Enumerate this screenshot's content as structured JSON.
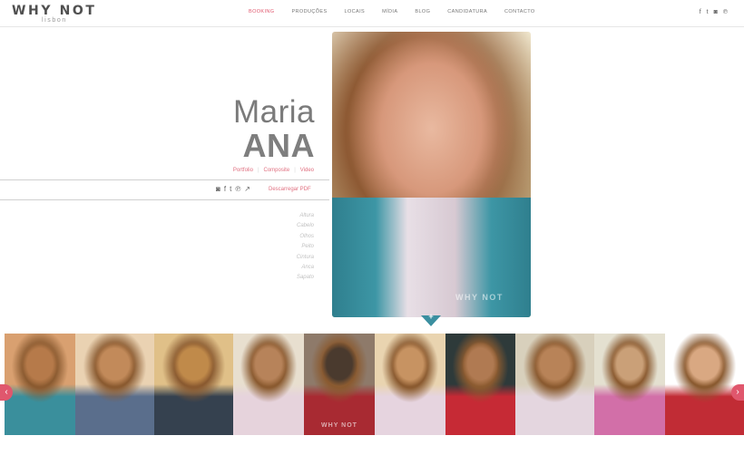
{
  "brand": {
    "logo": "WHY NOT",
    "tagline": "lisbon"
  },
  "nav": {
    "items": [
      {
        "label": "BOOKING",
        "active": true
      },
      {
        "label": "PRODUÇÕES",
        "active": false
      },
      {
        "label": "LOCAIS",
        "active": false
      },
      {
        "label": "MÍDIA",
        "active": false
      },
      {
        "label": "BLOG",
        "active": false
      },
      {
        "label": "CANDIDATURA",
        "active": false
      },
      {
        "label": "CONTACTO",
        "active": false
      }
    ],
    "social": [
      {
        "icon": "facebook-icon",
        "glyph": "f"
      },
      {
        "icon": "twitter-icon",
        "glyph": "t"
      },
      {
        "icon": "instagram-icon",
        "glyph": "◙"
      },
      {
        "icon": "pinterest-icon",
        "glyph": "℗"
      }
    ]
  },
  "profile": {
    "first_name": "Maria",
    "last_name": "ANA",
    "tabs": [
      "Portfolio",
      "Composite",
      "Video"
    ],
    "share_icons": [
      {
        "icon": "instagram-icon",
        "glyph": "◙"
      },
      {
        "icon": "facebook-icon",
        "glyph": "f"
      },
      {
        "icon": "twitter-icon",
        "glyph": "t"
      },
      {
        "icon": "pinterest-icon",
        "glyph": "℗"
      },
      {
        "icon": "external-link-icon",
        "glyph": "↗"
      }
    ],
    "download_label": "Descarregar PDF",
    "measures": [
      "Altura",
      "Cabelo",
      "Olhos",
      "Peito",
      "Cintura",
      "Anca",
      "Sapato"
    ]
  },
  "main_photo": {
    "watermark": "WHY NOT",
    "expand_glyph": "+"
  },
  "thumbnails": [
    {
      "name": "thumb-1",
      "watermark": "",
      "colors": [
        "#d9a070",
        "#b67a4a",
        "#3a8f9c"
      ]
    },
    {
      "name": "thumb-2",
      "watermark": "",
      "colors": [
        "#ead2b2",
        "#c28a5a",
        "#5a6e8c"
      ]
    },
    {
      "name": "thumb-3",
      "watermark": "",
      "colors": [
        "#e0c088",
        "#c08a4a",
        "#35414f"
      ]
    },
    {
      "name": "thumb-4",
      "watermark": "",
      "colors": [
        "#e8dfcf",
        "#b7835a",
        "#e6d3dc"
      ]
    },
    {
      "name": "thumb-5",
      "watermark": "WHY NOT",
      "colors": [
        "#8e7a6a",
        "#4a3a2e",
        "#a82a32"
      ]
    },
    {
      "name": "thumb-6",
      "watermark": "",
      "colors": [
        "#e9d4b0",
        "#c79362",
        "#e6d4df"
      ]
    },
    {
      "name": "thumb-7",
      "watermark": "",
      "colors": [
        "#2e3a3a",
        "#b07a52",
        "#c62a35"
      ]
    },
    {
      "name": "thumb-8",
      "watermark": "",
      "colors": [
        "#d8d0bc",
        "#b88358",
        "#e4d6df"
      ]
    },
    {
      "name": "thumb-9",
      "watermark": "",
      "colors": [
        "#e4e0d0",
        "#caa078",
        "#d26fa8"
      ]
    },
    {
      "name": "thumb-10",
      "watermark": "",
      "colors": [
        "#ffffff",
        "#d9a882",
        "#c12c35"
      ]
    }
  ],
  "carousel": {
    "prev_glyph": "‹",
    "next_glyph": "›",
    "badge_glyph": "+"
  }
}
